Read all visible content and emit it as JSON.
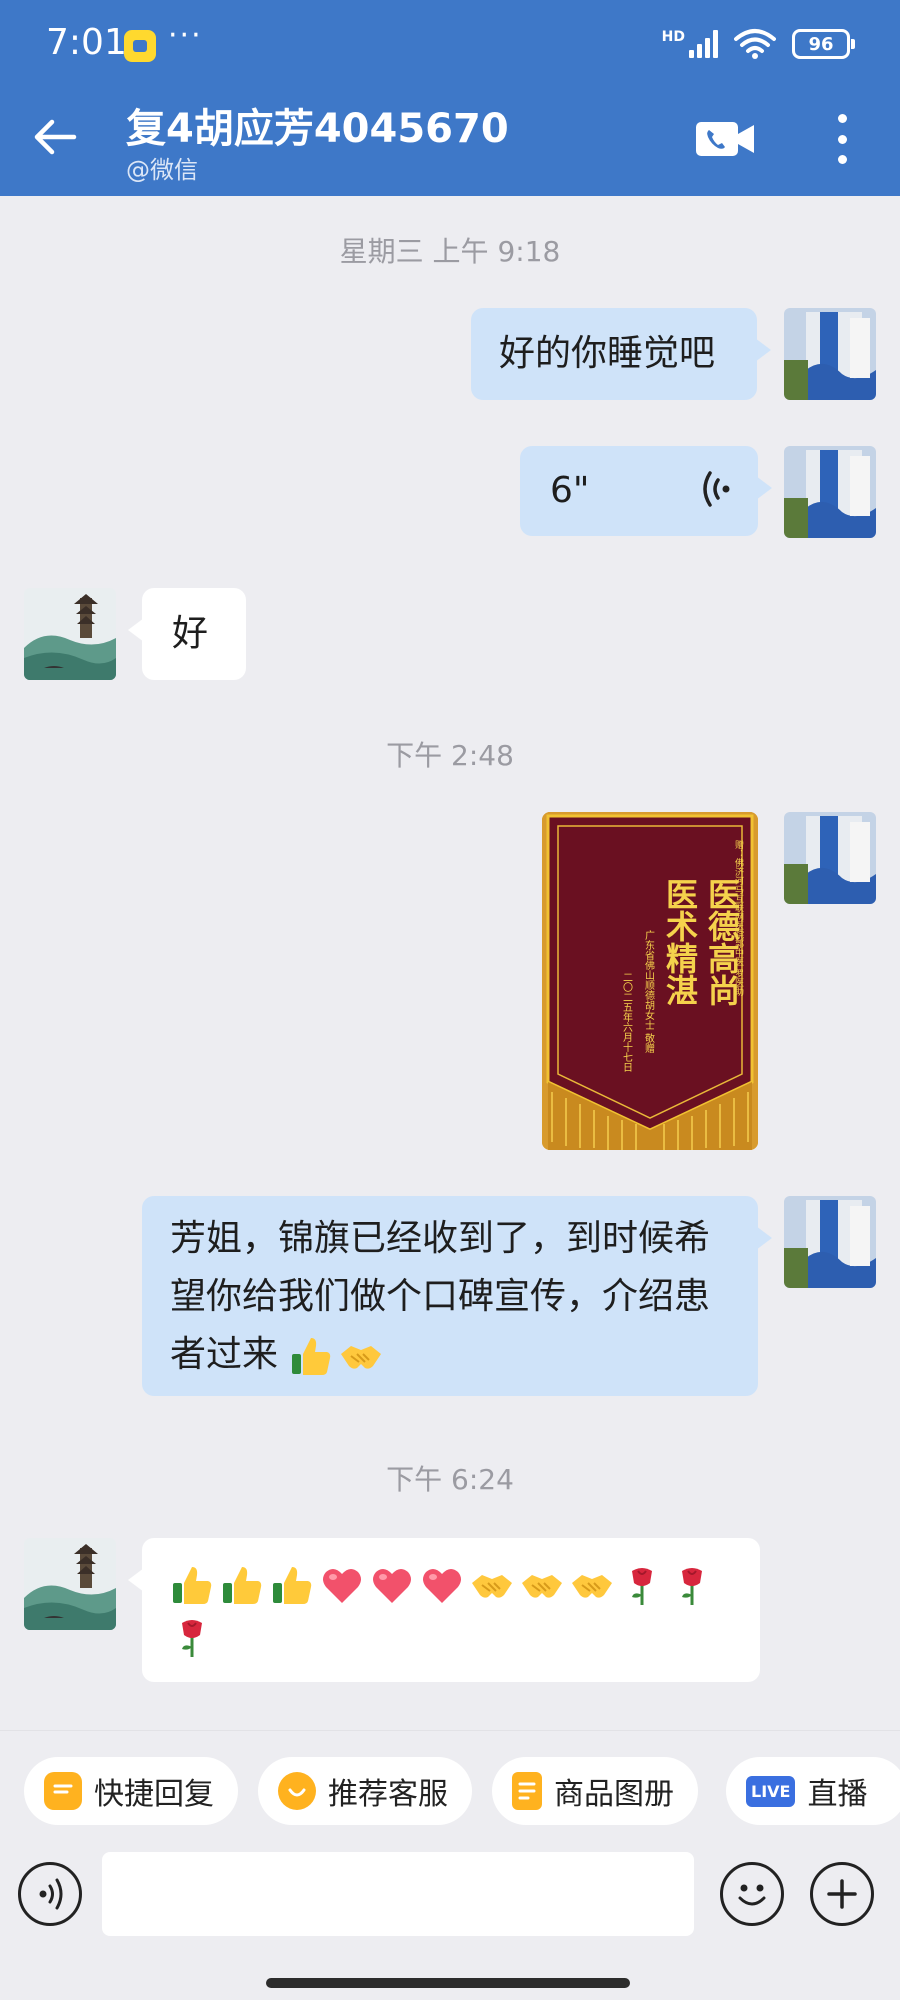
{
  "status_bar": {
    "time": "7:01",
    "dots": "···",
    "network": "HD",
    "battery": "96"
  },
  "header": {
    "title": "复4胡应芳4045670",
    "subtitle": "@微信"
  },
  "messages": {
    "ts1": "星期三  上午 9:18",
    "msg1": "好的你睡觉吧",
    "voice_duration": "6\"",
    "msg2": "好",
    "ts2": "下午 2:48",
    "banner": {
      "top_right": "赠：佛济河马互联网医院郭中医 罗医助",
      "main_line1": "医德高尚",
      "main_line2": "医术精湛",
      "donor": "广东省佛山顺德胡女士 敬赠",
      "date": "二〇二五年六月十七日"
    },
    "msg3": "芳姐，锦旗已经收到了，到时候希望你给我们做个口碑宣传，介绍患者过来",
    "msg3_emojis": [
      "thumbs-up-icon",
      "handshake-icon"
    ],
    "ts3": "下午 6:24",
    "msg4_emojis": [
      "thumbs-up-icon",
      "thumbs-up-icon",
      "thumbs-up-icon",
      "heart-icon",
      "heart-icon",
      "heart-icon",
      "handshake-icon",
      "handshake-icon",
      "handshake-icon",
      "rose-icon",
      "rose-icon",
      "rose-icon"
    ]
  },
  "quick_bar": {
    "quick_reply": "快捷回复",
    "recommend_service": "推荐客服",
    "product_album": "商品图册",
    "live_badge": "LIVE",
    "live": "直播"
  },
  "input": {
    "placeholder": ""
  },
  "colors": {
    "header_bg": "#3e78c8",
    "my_bubble": "#cfe3f9",
    "other_bubble": "#ffffff",
    "chat_bg": "#ededf1"
  }
}
